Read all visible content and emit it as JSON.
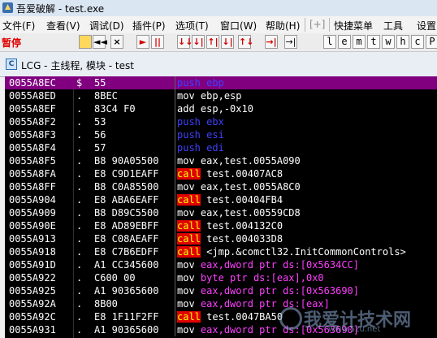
{
  "window": {
    "title": "吾爱破解 - test.exe"
  },
  "menu": {
    "items": [
      "文件(F)",
      "查看(V)",
      "调试(D)",
      "插件(P)",
      "选项(T)",
      "窗口(W)",
      "帮助(H)",
      "[+]",
      "快捷菜单",
      "工具",
      "设置"
    ]
  },
  "toolbar": {
    "status": "暂停",
    "buttons": [
      "◄◄",
      "×",
      "►",
      "||",
      "↓↓",
      "↓|",
      "↑|",
      "↓|",
      "↑↓",
      "→|",
      "→|"
    ],
    "letters": [
      "l",
      "e",
      "m",
      "t",
      "w",
      "h",
      "c",
      "P",
      "k"
    ]
  },
  "child_window": {
    "title": "LCG - 主线程, 模块 - test",
    "icon_label": "C"
  },
  "disasm": {
    "rows": [
      {
        "addr": "0055A8EC",
        "mark": "$",
        "hex": "55",
        "mn": "push",
        "ops": "ebp",
        "opstyle": "blue",
        "selected": true
      },
      {
        "addr": "0055A8ED",
        "mark": ".",
        "hex": "8BEC",
        "mn": "mov",
        "ops": "ebp,esp",
        "opstyle": "white"
      },
      {
        "addr": "0055A8EF",
        "mark": ".",
        "hex": "83C4 F0",
        "mn": "add",
        "ops": "esp,-0x10",
        "opstyle": "mixnum"
      },
      {
        "addr": "0055A8F2",
        "mark": ".",
        "hex": "53",
        "mn": "push",
        "ops": "ebx",
        "opstyle": "blue"
      },
      {
        "addr": "0055A8F3",
        "mark": ".",
        "hex": "56",
        "mn": "push",
        "ops": "esi",
        "opstyle": "blue"
      },
      {
        "addr": "0055A8F4",
        "mark": ".",
        "hex": "57",
        "mn": "push",
        "ops": "edi",
        "opstyle": "blue"
      },
      {
        "addr": "0055A8F5",
        "mark": ".",
        "hex": "B8 90A05500",
        "mn": "mov",
        "ops": "eax,test.0055A090",
        "opstyle": "white"
      },
      {
        "addr": "0055A8FA",
        "mark": ".",
        "hex": "E8 C9D1EAFF",
        "mn": "call",
        "ops": "test.00407AC8",
        "opstyle": "white"
      },
      {
        "addr": "0055A8FF",
        "mark": ".",
        "hex": "B8 C0A85500",
        "mn": "mov",
        "ops": "eax,test.0055A8C0",
        "opstyle": "white"
      },
      {
        "addr": "0055A904",
        "mark": ".",
        "hex": "E8 ABA6EAFF",
        "mn": "call",
        "ops": "test.00404FB4",
        "opstyle": "white"
      },
      {
        "addr": "0055A909",
        "mark": ".",
        "hex": "B8 D89C5500",
        "mn": "mov",
        "ops": "eax,test.00559CD8",
        "opstyle": "white"
      },
      {
        "addr": "0055A90E",
        "mark": ".",
        "hex": "E8 AD89EBFF",
        "mn": "call",
        "ops": "test.004132C0",
        "opstyle": "white"
      },
      {
        "addr": "0055A913",
        "mark": ".",
        "hex": "E8 C08AEAFF",
        "mn": "call",
        "ops": "test.004033D8",
        "opstyle": "white"
      },
      {
        "addr": "0055A918",
        "mark": ".",
        "hex": "E8 C7B6EDFF",
        "mn": "call",
        "ops": "<jmp.&comctl32.InitCommonControls>",
        "opstyle": "white"
      },
      {
        "addr": "0055A91D",
        "mark": ".",
        "hex": "A1 CC345600",
        "mn": "mov",
        "ops": "eax,dword ptr ds:[0x5634CC]",
        "opstyle": "mag"
      },
      {
        "addr": "0055A922",
        "mark": ".",
        "hex": "C600 00",
        "mn": "mov",
        "ops": "byte ptr ds:[eax],0x0",
        "opstyle": "mag"
      },
      {
        "addr": "0055A925",
        "mark": ".",
        "hex": "A1 90365600",
        "mn": "mov",
        "ops": "eax,dword ptr ds:[0x563690]",
        "opstyle": "mag"
      },
      {
        "addr": "0055A92A",
        "mark": ".",
        "hex": "8B00",
        "mn": "mov",
        "ops": "eax,dword ptr ds:[eax]",
        "opstyle": "mag"
      },
      {
        "addr": "0055A92C",
        "mark": ".",
        "hex": "E8 1F11F2FF",
        "mn": "call",
        "ops": "test.0047BA50",
        "opstyle": "white"
      },
      {
        "addr": "0055A931",
        "mark": ".",
        "hex": "A1 90365600",
        "mn": "mov",
        "ops": "eax,dword ptr ds:[0x563690]",
        "opstyle": "mag"
      }
    ]
  },
  "watermark": {
    "text": "我爱计技术网",
    "sub": "www.5zu.net"
  },
  "colors": {
    "selected_row": "#800080",
    "push": "#4040ff",
    "call_bg": "#e00000",
    "call_fg": "#ffff00",
    "memref": "#ff40ff",
    "status_red": "#e00000"
  }
}
